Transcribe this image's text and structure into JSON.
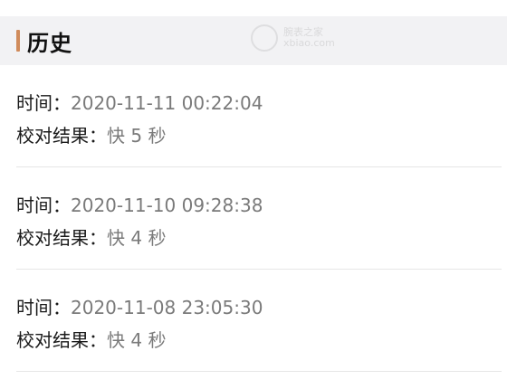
{
  "header": {
    "title": "历史",
    "accent_color": "#d08b5b",
    "watermark": {
      "text_top": "腕表之家",
      "text_bottom": "xbiao.com"
    }
  },
  "records": [
    {
      "time_label": "时间：",
      "time_value": "2020-11-11 00:22:04",
      "result_label": "校对结果：",
      "result_value": "快 5 秒"
    },
    {
      "time_label": "时间：",
      "time_value": "2020-11-10 09:28:38",
      "result_label": "校对结果：",
      "result_value": "快 4 秒"
    },
    {
      "time_label": "时间：",
      "time_value": "2020-11-08 23:05:30",
      "result_label": "校对结果：",
      "result_value": "快 4 秒"
    }
  ]
}
